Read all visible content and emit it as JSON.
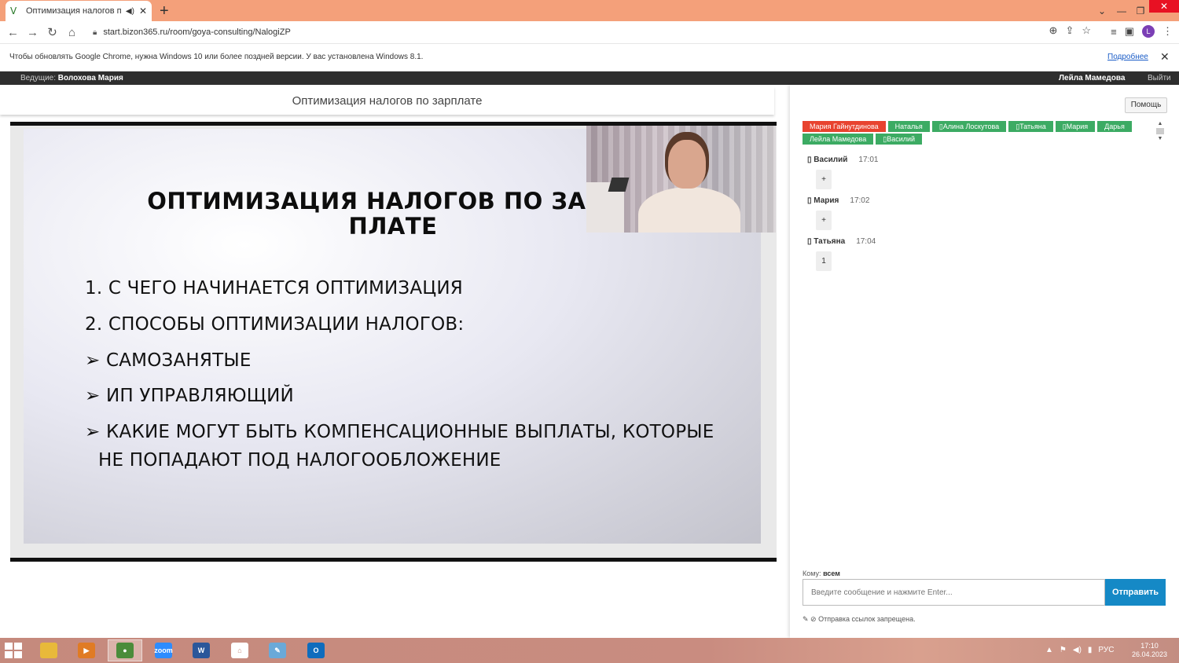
{
  "browser": {
    "tab_title": "Оптимизация налогов по зарплате",
    "url": "start.bizon365.ru/room/goya-consulting/NalogiZP",
    "profile_letter": "L",
    "info_message": "Чтобы обновлять Google Chrome, нужна Windows 10 или более поздней версии. У вас установлена Windows 8.1.",
    "info_link": "Подробнее"
  },
  "hostbar": {
    "host_label": "Ведущие:",
    "host_name": "Волохова Мария",
    "current_user": "Лейла Мамедова",
    "exit_label": "Выйти"
  },
  "room": {
    "title": "Оптимизация налогов по зарплате"
  },
  "slide": {
    "title_line1": "ОПТИМИЗАЦИЯ НАЛОГОВ ПО ЗАРАБ",
    "title_line2": "ПЛАТЕ",
    "items": [
      "1.  С ЧЕГО НАЧИНАЕТСЯ ОПТИМИЗАЦИЯ",
      "2.  СПОСОБЫ ОПТИМИЗАЦИИ НАЛОГОВ:",
      "➢ САМОЗАНЯТЫЕ",
      "➢ ИП УПРАВЛЯЮЩИЙ",
      "➢ КАКИЕ МОГУТ БЫТЬ КОМПЕНСАЦИОННЫЕ ВЫПЛАТЫ, КОТОРЫЕ",
      "НЕ ПОПАДАЮТ ПОД НАЛОГООБЛОЖЕНИЕ"
    ]
  },
  "chat": {
    "help_label": "Помощь",
    "participants": [
      {
        "name": "Мария Гайнутдинова",
        "color": "#e8432f"
      },
      {
        "name": "Наталья",
        "color": "#3cab63"
      },
      {
        "name": "▯Алина Лоскутова",
        "color": "#3cab63"
      },
      {
        "name": "▯Татьяна",
        "color": "#3cab63"
      },
      {
        "name": "▯Мария",
        "color": "#3cab63"
      },
      {
        "name": "Дарья",
        "color": "#3cab63"
      },
      {
        "name": "Лейла Мамедова",
        "color": "#3cab63"
      },
      {
        "name": "▯Василий",
        "color": "#3cab63"
      }
    ],
    "messages": [
      {
        "name": "▯ Василий",
        "time": "17:01",
        "text": "+"
      },
      {
        "name": "▯ Мария",
        "time": "17:02",
        "text": "+"
      },
      {
        "name": "▯ Татьяна",
        "time": "17:04",
        "text": "1"
      }
    ],
    "to_label": "Кому:",
    "to_value": "всем",
    "input_placeholder": "Введите сообщение и нажмите Enter...",
    "send_label": "Отправить",
    "note": "✎ ⊘ Отправка ссылок запрещена."
  },
  "taskbar": {
    "apps": [
      {
        "name": "explorer",
        "color": "#e8b93a",
        "label": ""
      },
      {
        "name": "media-player",
        "color": "#e07b24",
        "label": "▶"
      },
      {
        "name": "chrome",
        "color": "#4a8c3a",
        "label": "●"
      },
      {
        "name": "zoom",
        "color": "#2d8cff",
        "label": "zoom"
      },
      {
        "name": "word",
        "color": "#2b579a",
        "label": "W"
      },
      {
        "name": "home",
        "color": "#ffffff",
        "label": "⌂"
      },
      {
        "name": "paint",
        "color": "#6aa9d8",
        "label": "✎"
      },
      {
        "name": "outlook",
        "color": "#0f6cbd",
        "label": "O"
      }
    ],
    "lang": "РУС",
    "time": "17:10",
    "date": "26.04.2023"
  }
}
